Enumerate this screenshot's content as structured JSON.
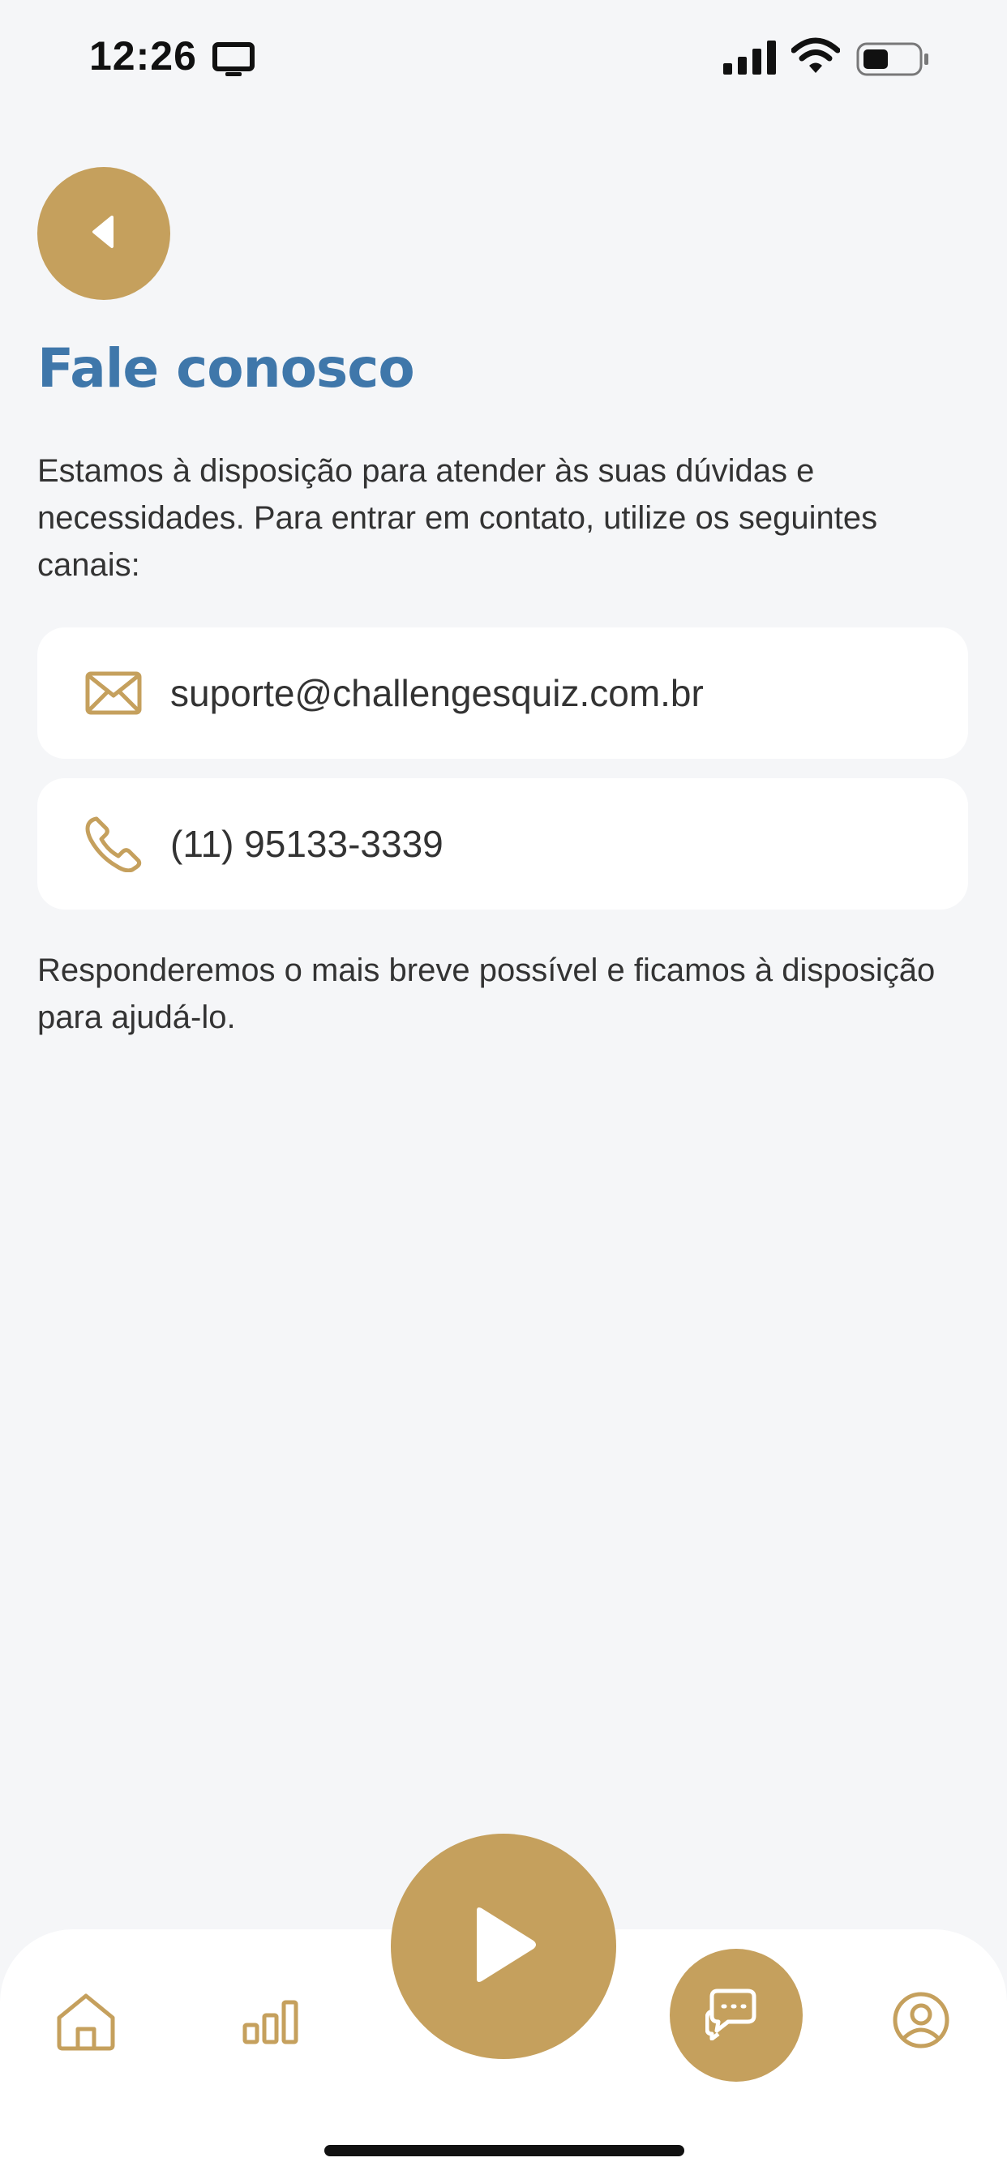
{
  "status_bar": {
    "time": "12:26"
  },
  "header": {
    "title": "Fale conosco"
  },
  "content": {
    "intro": "Estamos à disposição para atender às suas dúvidas e necessidades. Para entrar em contato, utilize os seguintes canais:",
    "contacts": [
      {
        "icon": "mail-icon",
        "value": "suporte@challengesquiz.com.br"
      },
      {
        "icon": "phone-icon",
        "value": "(11) 95133-3339"
      }
    ],
    "outro": "Responderemos o mais breve possível e ficamos à disposição para ajudá-lo."
  },
  "nav": {
    "items": [
      {
        "icon": "home-icon"
      },
      {
        "icon": "ranking-icon"
      },
      {
        "icon": "play-icon"
      },
      {
        "icon": "chat-icon",
        "active": true
      },
      {
        "icon": "profile-icon"
      }
    ]
  },
  "colors": {
    "accent": "#c5a05d",
    "title": "#3f77aa",
    "background": "#f5f6f8",
    "card": "#ffffff"
  }
}
